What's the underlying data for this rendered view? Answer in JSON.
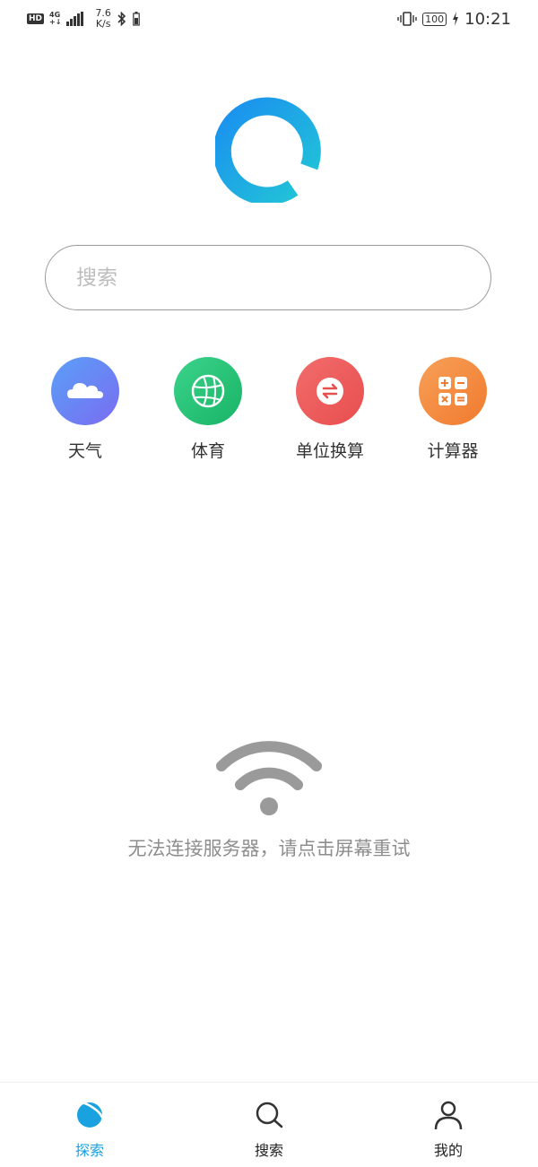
{
  "status_bar": {
    "hd": "HD",
    "network_top": "4G",
    "network_bottom": "+↓",
    "speed_value": "7.6",
    "speed_unit": "K/s",
    "battery": "100",
    "time": "10:21"
  },
  "search": {
    "placeholder": "搜索"
  },
  "shortcuts": [
    {
      "label": "天气",
      "icon": "cloud-icon",
      "color": "#6a84f5"
    },
    {
      "label": "体育",
      "icon": "basketball-icon",
      "color": "#2fc67a"
    },
    {
      "label": "单位换算",
      "icon": "swap-arrows-icon",
      "color": "#f05a5a"
    },
    {
      "label": "计算器",
      "icon": "calculator-icon",
      "color": "#f6873d"
    }
  ],
  "error": {
    "message": "无法连接服务器，请点击屏幕重试"
  },
  "bottom_nav": [
    {
      "label": "探索",
      "icon": "planet-icon",
      "active": true
    },
    {
      "label": "搜索",
      "icon": "search-icon",
      "active": false
    },
    {
      "label": "我的",
      "icon": "user-icon",
      "active": false
    }
  ],
  "colors": {
    "accent": "#1aa2e0",
    "text": "#333333",
    "muted": "#8e8e8e"
  }
}
